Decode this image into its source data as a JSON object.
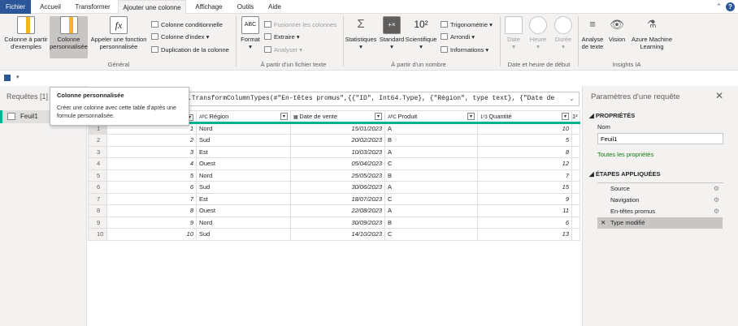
{
  "menu": {
    "tabs": [
      "Fichier",
      "Accueil",
      "Transformer",
      "Ajouter une colonne",
      "Affichage",
      "Outils",
      "Aide"
    ],
    "active": "Ajouter une colonne"
  },
  "ribbon": {
    "general": {
      "col_exemples": "Colonne à partir d'exemples",
      "col_perso": "Colonne personnalisée",
      "appeler_fn": "Appeler une fonction personnalisée",
      "col_cond": "Colonne conditionnelle",
      "col_index": "Colonne d'index",
      "duplication": "Duplication de la colonne",
      "group": "Général"
    },
    "texte": {
      "format": "Format",
      "fusion": "Fusionner les colonnes",
      "extraire": "Extraire",
      "analyser": "Analyser",
      "group": "À partir d'un fichier texte"
    },
    "nombre": {
      "statistiques": "Statistiques",
      "standard": "Standard",
      "scientifique": "Scientifique",
      "trigo": "Trigonométrie",
      "arrondi": "Arrondi",
      "informations": "Informations",
      "group": "À partir d'un nombre"
    },
    "date": {
      "date": "Date",
      "heure": "Heure",
      "duree": "Durée",
      "group": "Date et heure de début"
    },
    "ia": {
      "texte": "Analyse de texte",
      "vision": "Vision",
      "azure": "Azure Machine Learning",
      "group": "Insights IA"
    }
  },
  "left_pane": {
    "title": "Requêtes [1]",
    "query": "Feuil1"
  },
  "tooltip": {
    "title": "Colonne personnalisée",
    "text": "Créer une colonne avec cette table d'après une formule personnalisée."
  },
  "formula": {
    "text": ".TransformColumnTypes(#\"En-têtes promus\",{{\"ID\", Int64.Type}, {\"Région\", type text}, {\"Date de"
  },
  "table": {
    "columns": [
      "",
      "Région",
      "Date de vente",
      "Produit",
      "Quantité",
      "1²"
    ],
    "column_types": [
      "",
      "ABC",
      "date",
      "ABC",
      "123",
      ""
    ],
    "rows": [
      {
        "n": "1",
        "id": "1",
        "region": "Nord",
        "date": "15/01/2023",
        "produit": "A",
        "qte": "10"
      },
      {
        "n": "2",
        "id": "2",
        "region": "Sud",
        "date": "20/02/2023",
        "produit": "B",
        "qte": "5"
      },
      {
        "n": "3",
        "id": "3",
        "region": "Est",
        "date": "10/03/2023",
        "produit": "A",
        "qte": "8"
      },
      {
        "n": "4",
        "id": "4",
        "region": "Ouest",
        "date": "05/04/2023",
        "produit": "C",
        "qte": "12"
      },
      {
        "n": "5",
        "id": "5",
        "region": "Nord",
        "date": "25/05/2023",
        "produit": "B",
        "qte": "7"
      },
      {
        "n": "6",
        "id": "6",
        "region": "Sud",
        "date": "30/06/2023",
        "produit": "A",
        "qte": "15"
      },
      {
        "n": "7",
        "id": "7",
        "region": "Est",
        "date": "18/07/2023",
        "produit": "C",
        "qte": "9"
      },
      {
        "n": "8",
        "id": "8",
        "region": "Ouest",
        "date": "22/08/2023",
        "produit": "A",
        "qte": "11"
      },
      {
        "n": "9",
        "id": "9",
        "region": "Nord",
        "date": "30/09/2023",
        "produit": "B",
        "qte": "6"
      },
      {
        "n": "10",
        "id": "10",
        "region": "Sud",
        "date": "14/10/2023",
        "produit": "C",
        "qte": "13"
      }
    ]
  },
  "right_pane": {
    "title": "Paramètres d'une requête",
    "props_header": "PROPRIÉTÉS",
    "nom_label": "Nom",
    "nom_value": "Feuil1",
    "all_props": "Toutes les propriétés",
    "steps_header": "ÉTAPES APPLIQUÉES",
    "steps": [
      "Source",
      "Navigation",
      "En-têtes promus",
      "Type modifié"
    ]
  },
  "colors": {
    "accent": "#2b579a",
    "teal": "#00b294",
    "link": "#107c10"
  }
}
